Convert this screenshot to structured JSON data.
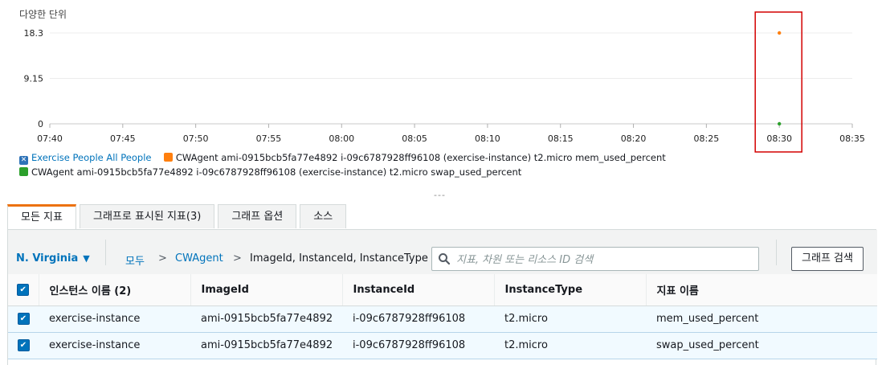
{
  "chart": {
    "unit_label": "다양한 단위",
    "highlight_color": "#d40000"
  },
  "chart_data": {
    "type": "scatter",
    "xlabel": "",
    "ylabel": "다양한 단위",
    "x_ticks": [
      "07:40",
      "07:45",
      "07:50",
      "07:55",
      "08:00",
      "08:05",
      "08:10",
      "08:15",
      "08:20",
      "08:25",
      "08:30",
      "08:35"
    ],
    "y_ticks": [
      "0",
      "9.15",
      "18.3"
    ],
    "ylim": [
      0,
      18.3
    ],
    "xlim": [
      "07:40",
      "08:35"
    ],
    "grid": true,
    "legend_position": "bottom",
    "series": [
      {
        "name": "CWAgent ami-0915bcb5fa77e4892 i-09c6787928ff96108 (exercise-instance) t2.micro mem_used_percent",
        "color": "#ff7f0e",
        "points": [
          {
            "x": "08:30",
            "y": 18.3
          }
        ]
      },
      {
        "name": "CWAgent ami-0915bcb5fa77e4892 i-09c6787928ff96108 (exercise-instance) t2.micro swap_used_percent",
        "color": "#2ca02c",
        "points": [
          {
            "x": "08:30",
            "y": 0
          }
        ]
      }
    ]
  },
  "legend": {
    "all_label": "Exercise People All People",
    "items": [
      {
        "label": "CWAgent ami-0915bcb5fa77e4892 i-09c6787928ff96108 (exercise-instance) t2.micro mem_used_percent",
        "color": "#ff7f0e"
      },
      {
        "label": "CWAgent ami-0915bcb5fa77e4892 i-09c6787928ff96108 (exercise-instance) t2.micro swap_used_percent",
        "color": "#2ca02c"
      }
    ]
  },
  "resize_handle": "---",
  "tabs": [
    {
      "label": "모든 지표",
      "active": true
    },
    {
      "label": "그래프로 표시된 지표(3)",
      "active": false
    },
    {
      "label": "그래프 옵션",
      "active": false
    },
    {
      "label": "소스",
      "active": false
    }
  ],
  "toolbar": {
    "region": "N. Virginia",
    "breadcrumb": [
      "모두",
      "CWAgent",
      "ImageId, InstanceId, InstanceType"
    ],
    "breadcrumb_sep": ">",
    "search_placeholder": "지표, 차원 또는 리소스 ID 검색",
    "search_value": "",
    "search_button": "그래프 검색"
  },
  "table": {
    "columns": [
      "인스턴스 이름 (2)",
      "ImageId",
      "InstanceId",
      "InstanceType",
      "지표 이름"
    ],
    "rows": [
      [
        "exercise-instance",
        "ami-0915bcb5fa77e4892",
        "i-09c6787928ff96108",
        "t2.micro",
        "mem_used_percent"
      ],
      [
        "exercise-instance",
        "ami-0915bcb5fa77e4892",
        "i-09c6787928ff96108",
        "t2.micro",
        "swap_used_percent"
      ]
    ],
    "checked": "✔"
  },
  "colors": {
    "accent_tab": "#ec7211",
    "link": "#0073bb",
    "selected_row": "#f1faff"
  }
}
